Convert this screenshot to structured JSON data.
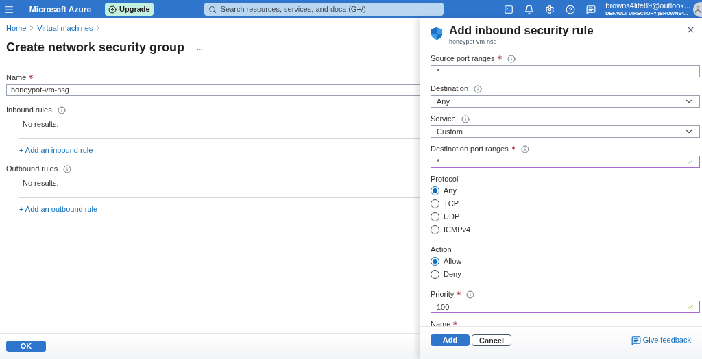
{
  "topbar": {
    "brand": "Microsoft Azure",
    "upgrade": "Upgrade",
    "search_placeholder": "Search resources, services, and docs (G+/)",
    "account": "browns4life89@outlook...",
    "directory": "DEFAULT DIRECTORY (BROWNS4..."
  },
  "breadcrumb": [
    "Home",
    "Virtual machines"
  ],
  "page": {
    "title": "Create network security group",
    "more": "...",
    "name_label": "Name",
    "name_required": true,
    "name_value": "honeypot-vm-nsg",
    "sections": [
      {
        "label": "Inbound rules",
        "empty": "No results.",
        "link": "+ Add an inbound rule"
      },
      {
        "label": "Outbound rules",
        "empty": "No results.",
        "link": "+ Add an outbound rule"
      }
    ],
    "ok": "OK"
  },
  "panel": {
    "title": "Add inbound security rule",
    "subtitle": "honeypot-vm-nsg",
    "fields": [
      {
        "kind": "input",
        "label": "Source port ranges",
        "required": true,
        "info": true,
        "value": "*",
        "validated": false
      },
      {
        "kind": "select",
        "label": "Destination",
        "required": false,
        "info": true,
        "value": "Any"
      },
      {
        "kind": "select",
        "label": "Service",
        "required": false,
        "info": true,
        "value": "Custom"
      },
      {
        "kind": "input",
        "label": "Destination port ranges",
        "required": true,
        "info": true,
        "value": "*",
        "validated": true
      },
      {
        "kind": "radio",
        "label": "Protocol",
        "options": [
          {
            "label": "Any",
            "selected": true
          },
          {
            "label": "TCP",
            "selected": false
          },
          {
            "label": "UDP",
            "selected": false
          },
          {
            "label": "ICMPv4",
            "selected": false
          }
        ]
      },
      {
        "kind": "radio",
        "label": "Action",
        "options": [
          {
            "label": "Allow",
            "selected": true
          },
          {
            "label": "Deny",
            "selected": false
          }
        ]
      },
      {
        "kind": "input",
        "label": "Priority",
        "required": true,
        "info": true,
        "value": "100",
        "validated": true
      },
      {
        "kind": "label",
        "label": "Name",
        "required": true
      }
    ],
    "add": "Add",
    "cancel": "Cancel",
    "feedback": "Give feedback"
  }
}
